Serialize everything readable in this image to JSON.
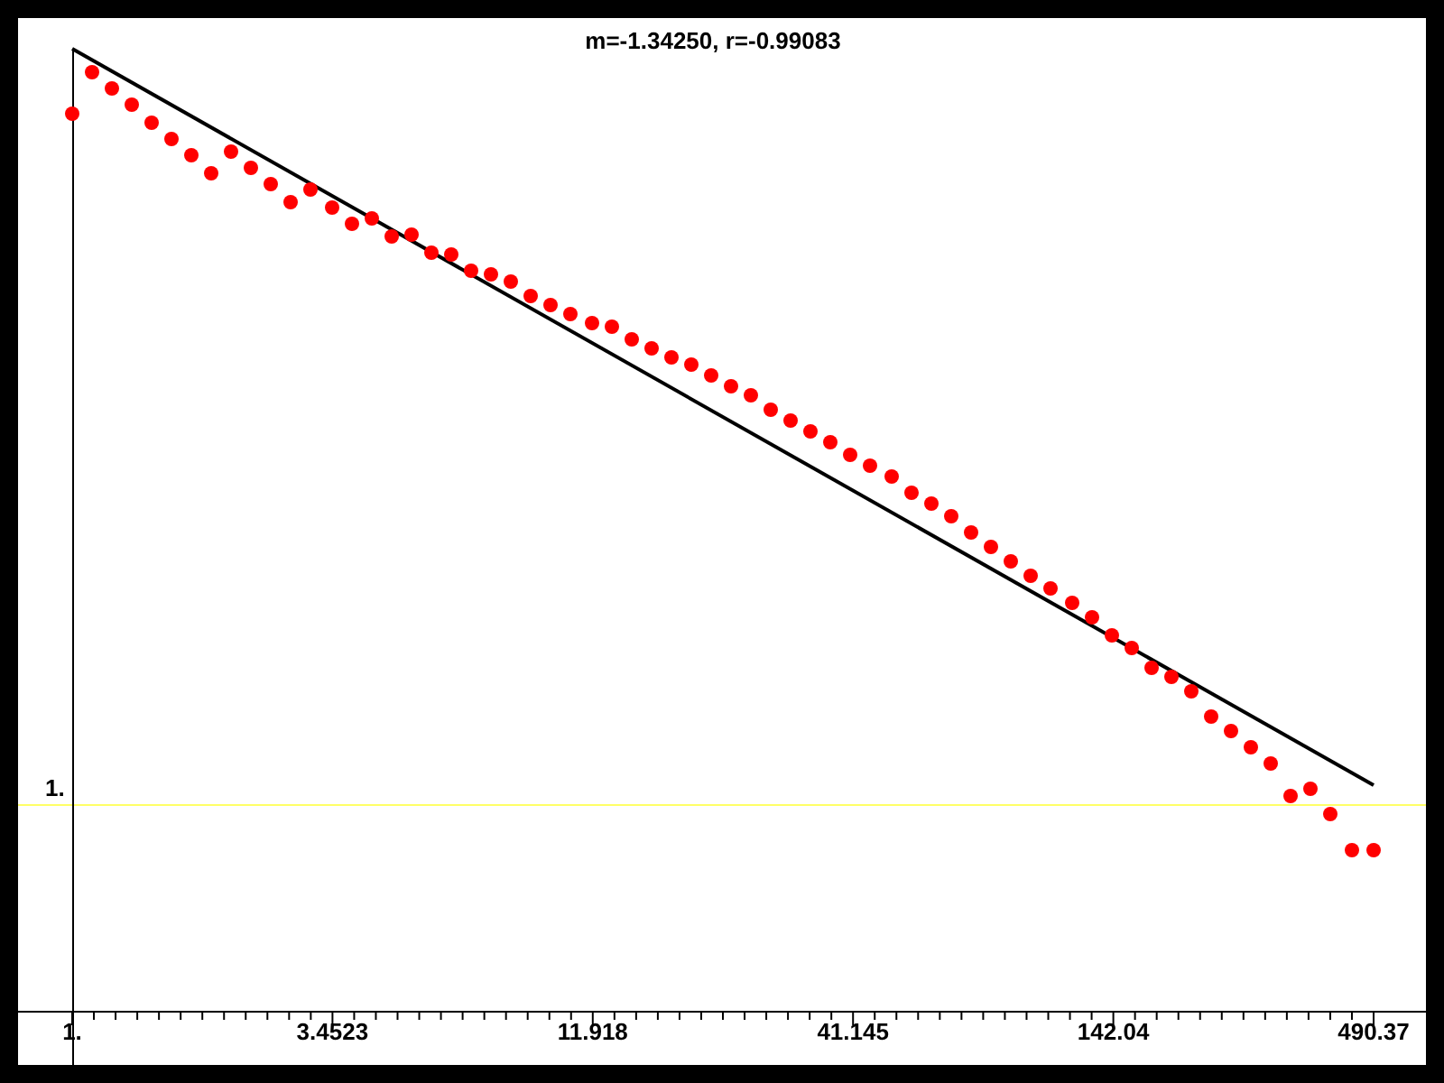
{
  "chart": {
    "title": "m=-1.34250, r=-0.99083",
    "y_tick_label": "1.",
    "x_tick_labels": [
      "1.",
      "3.4523",
      "11.918",
      "41.145",
      "142.04",
      "490.37"
    ]
  }
}
